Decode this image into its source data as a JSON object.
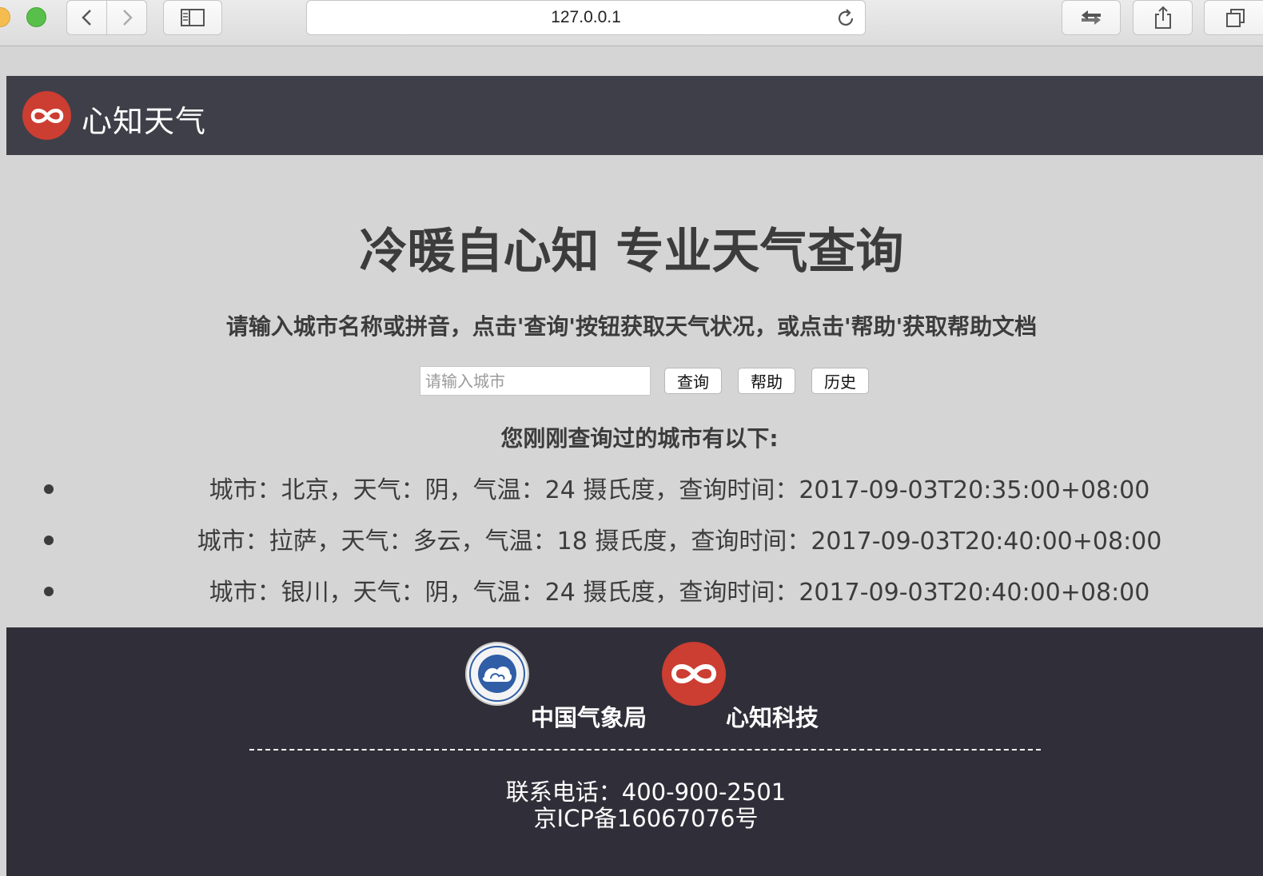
{
  "browser": {
    "url": "127.0.0.1"
  },
  "header": {
    "brand_name": "心知天气"
  },
  "main": {
    "title": "冷暖自心知 专业天气查询",
    "subtitle": "请输入城市名称或拼音，点击'查询'按钮获取天气状况，或点击'帮助'获取帮助文档",
    "search": {
      "placeholder": "请输入城市",
      "value": "",
      "query_label": "查询",
      "help_label": "帮助",
      "history_label": "历史"
    },
    "history_heading": "您刚刚查询过的城市有以下:",
    "history": [
      "城市：北京，天气：阴，气温：24 摄氏度，查询时间：2017-09-03T20:35:00+08:00",
      "城市：拉萨，天气：多云，气温：18 摄氏度，查询时间：2017-09-03T20:40:00+08:00",
      "城市：银川，天气：阴，气温：24 摄氏度，查询时间：2017-09-03T20:40:00+08:00"
    ]
  },
  "footer": {
    "cma_name": "中国气象局",
    "xinzhi_name": "心知科技",
    "phone": "联系电话：400-900-2501",
    "icp": "京ICP备16067076号"
  },
  "colors": {
    "brand_red": "#cc3d32",
    "header_bg": "#3f3f49",
    "footer_bg": "#302f39",
    "page_bg": "#d5d5d5"
  },
  "icons": {
    "back": "chevron-left-icon",
    "forward": "chevron-right-icon",
    "sidebar": "sidebar-icon",
    "reload": "reload-icon",
    "transfer": "transfer-icon",
    "share": "share-icon",
    "tabs": "tabs-icon",
    "logo": "infinity-logo-icon"
  }
}
